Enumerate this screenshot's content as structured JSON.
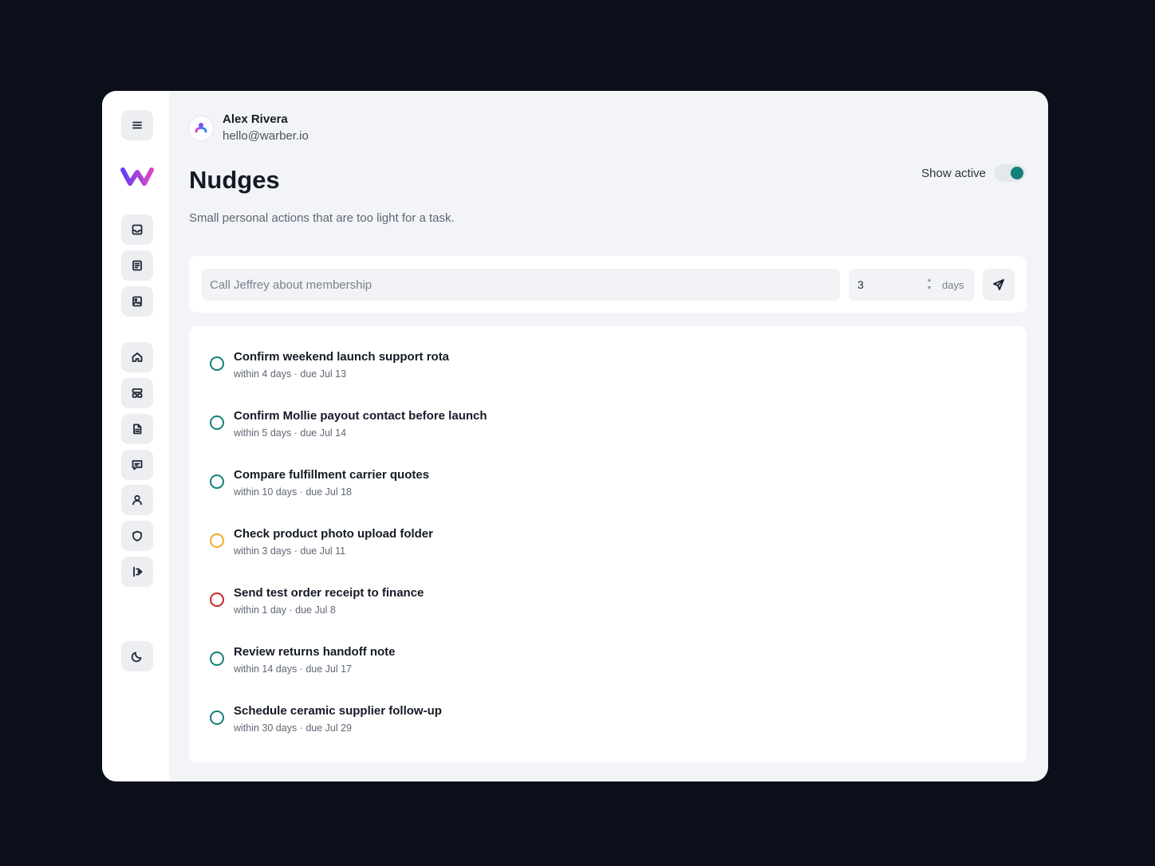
{
  "colors": {
    "accent": "#14807a",
    "status_ok": "#14807a",
    "status_warn": "#f0a928",
    "status_urgent": "#c62828",
    "logo_start": "#6a3df0",
    "logo_end": "#d945c9"
  },
  "sidebar": {
    "menu_icon": "menu-icon",
    "logo_icon": "w-logo",
    "top_items": [
      "inbox-icon",
      "notes-icon",
      "image-doc-icon"
    ],
    "nav_items": [
      "home-icon",
      "layout-icon",
      "document-icon",
      "chat-icon",
      "user-icon",
      "shield-icon",
      "logout-icon"
    ],
    "theme_icon": "moon-icon"
  },
  "user": {
    "name": "Alex Rivera",
    "email": "hello@warber.io"
  },
  "page": {
    "title": "Nudges",
    "subtitle": "Small personal actions that are too light for a task."
  },
  "filter": {
    "label": "Show active",
    "checked": true
  },
  "composer": {
    "placeholder": "Call Jeffrey about membership",
    "days_value": "3",
    "days_unit": "days",
    "send_icon": "send-icon"
  },
  "nudges": [
    {
      "title": "Confirm weekend launch support rota",
      "meta": "within 4 days · due Jul 13",
      "status": "ok"
    },
    {
      "title": "Confirm Mollie payout contact before launch",
      "meta": "within 5 days · due Jul 14",
      "status": "ok"
    },
    {
      "title": "Compare fulfillment carrier quotes",
      "meta": "within 10 days · due Jul 18",
      "status": "ok"
    },
    {
      "title": "Check product photo upload folder",
      "meta": "within 3 days · due Jul 11",
      "status": "warn"
    },
    {
      "title": "Send test order receipt to finance",
      "meta": "within 1 day · due Jul 8",
      "status": "urgent"
    },
    {
      "title": "Review returns handoff note",
      "meta": "within 14 days · due Jul 17",
      "status": "ok"
    },
    {
      "title": "Schedule ceramic supplier follow-up",
      "meta": "within 30 days · due Jul 29",
      "status": "ok"
    }
  ]
}
